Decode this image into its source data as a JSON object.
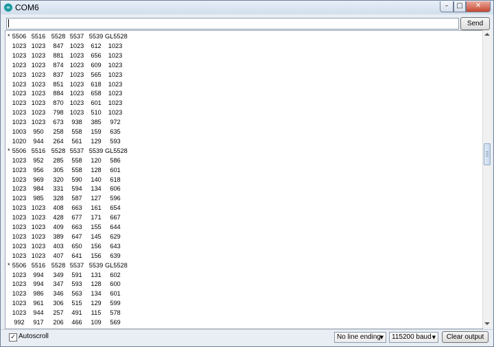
{
  "window": {
    "title": "COM6",
    "app_icon_glyph": "∞"
  },
  "controls": {
    "minimize": "–",
    "maximize": "□",
    "close": "✕"
  },
  "send_bar": {
    "input_value": "",
    "send_label": "Send"
  },
  "output": {
    "header": [
      "5506",
      "5516",
      "5528",
      "5537",
      "5539",
      "GL5528"
    ],
    "lines": [
      {
        "m": "*",
        "v": [
          "5506",
          "5516",
          "5528",
          "5537",
          "5539",
          "GL5528"
        ]
      },
      {
        "m": "",
        "v": [
          "1023",
          "1023",
          "847",
          "1023",
          "612",
          "1023"
        ]
      },
      {
        "m": "",
        "v": [
          "1023",
          "1023",
          "881",
          "1023",
          "656",
          "1023"
        ]
      },
      {
        "m": "",
        "v": [
          "1023",
          "1023",
          "874",
          "1023",
          "609",
          "1023"
        ]
      },
      {
        "m": "",
        "v": [
          "1023",
          "1023",
          "837",
          "1023",
          "565",
          "1023"
        ]
      },
      {
        "m": "",
        "v": [
          "1023",
          "1023",
          "851",
          "1023",
          "618",
          "1023"
        ]
      },
      {
        "m": "",
        "v": [
          "1023",
          "1023",
          "884",
          "1023",
          "658",
          "1023"
        ]
      },
      {
        "m": "",
        "v": [
          "1023",
          "1023",
          "870",
          "1023",
          "601",
          "1023"
        ]
      },
      {
        "m": "",
        "v": [
          "1023",
          "1023",
          "798",
          "1023",
          "510",
          "1023"
        ]
      },
      {
        "m": "",
        "v": [
          "1023",
          "1023",
          "673",
          "938",
          "385",
          "972"
        ]
      },
      {
        "m": "",
        "v": [
          "1003",
          "950",
          "258",
          "558",
          "159",
          "635"
        ]
      },
      {
        "m": "",
        "v": [
          "1020",
          "944",
          "264",
          "561",
          "129",
          "593"
        ]
      },
      {
        "m": "*",
        "v": [
          "5506",
          "5516",
          "5528",
          "5537",
          "5539",
          "GL5528"
        ]
      },
      {
        "m": "",
        "v": [
          "1023",
          "952",
          "285",
          "558",
          "120",
          "586"
        ]
      },
      {
        "m": "",
        "v": [
          "1023",
          "956",
          "305",
          "558",
          "128",
          "601"
        ]
      },
      {
        "m": "",
        "v": [
          "1023",
          "969",
          "320",
          "590",
          "140",
          "618"
        ]
      },
      {
        "m": "",
        "v": [
          "1023",
          "984",
          "331",
          "594",
          "134",
          "606"
        ]
      },
      {
        "m": "",
        "v": [
          "1023",
          "985",
          "328",
          "587",
          "127",
          "596"
        ]
      },
      {
        "m": "",
        "v": [
          "1023",
          "1023",
          "408",
          "663",
          "161",
          "654"
        ]
      },
      {
        "m": "",
        "v": [
          "1023",
          "1023",
          "428",
          "677",
          "171",
          "667"
        ]
      },
      {
        "m": "",
        "v": [
          "1023",
          "1023",
          "409",
          "663",
          "155",
          "644"
        ]
      },
      {
        "m": "",
        "v": [
          "1023",
          "1023",
          "389",
          "647",
          "145",
          "629"
        ]
      },
      {
        "m": "",
        "v": [
          "1023",
          "1023",
          "403",
          "650",
          "156",
          "643"
        ]
      },
      {
        "m": "",
        "v": [
          "1023",
          "1023",
          "407",
          "641",
          "156",
          "639"
        ]
      },
      {
        "m": "*",
        "v": [
          "5506",
          "5516",
          "5528",
          "5537",
          "5539",
          "GL5528"
        ]
      },
      {
        "m": "",
        "v": [
          "1023",
          "994",
          "349",
          "591",
          "131",
          "602"
        ]
      },
      {
        "m": "",
        "v": [
          "1023",
          "994",
          "347",
          "593",
          "128",
          "600"
        ]
      },
      {
        "m": "",
        "v": [
          "1023",
          "986",
          "346",
          "563",
          "134",
          "601"
        ]
      },
      {
        "m": "",
        "v": [
          "1023",
          "961",
          "306",
          "515",
          "129",
          "599"
        ]
      },
      {
        "m": "",
        "v": [
          "1023",
          "944",
          "257",
          "491",
          "115",
          "578"
        ]
      },
      {
        "m": "",
        "v": [
          "992",
          "917",
          "206",
          "466",
          "109",
          "569"
        ]
      }
    ]
  },
  "footer": {
    "autoscroll_checked": true,
    "autoscroll_check_glyph": "✓",
    "autoscroll_label": "Autoscroll",
    "line_ending_value": "No line ending",
    "baud_value": "115200 baud",
    "chevron_glyph": "▼",
    "clear_label": "Clear output"
  },
  "colors": {
    "title_bg": "#d3deec",
    "close_button": "#c7462f",
    "window_frame": "#6e7f95"
  }
}
